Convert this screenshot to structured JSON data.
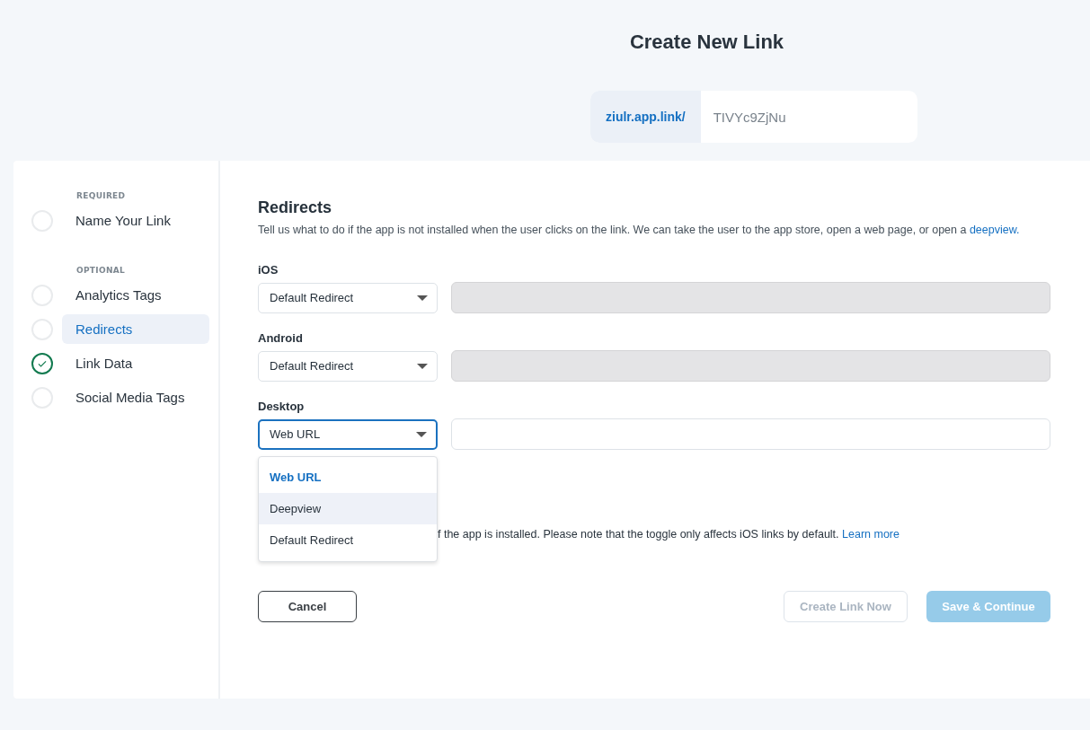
{
  "title": "Create New Link",
  "link": {
    "domain": "ziulr.app.link/",
    "slug": "TIVYc9ZjNu"
  },
  "sidebar": {
    "groups": [
      {
        "heading": "REQUIRED",
        "items": [
          {
            "label": "Name Your Link",
            "selected": false,
            "completed": false
          }
        ]
      },
      {
        "heading": "OPTIONAL",
        "items": [
          {
            "label": "Analytics Tags",
            "selected": false,
            "completed": false
          },
          {
            "label": "Redirects",
            "selected": true,
            "completed": false
          },
          {
            "label": "Link Data",
            "selected": false,
            "completed": true
          },
          {
            "label": "Social Media Tags",
            "selected": false,
            "completed": false
          }
        ]
      }
    ]
  },
  "section": {
    "heading": "Redirects",
    "description": "Tell us what to do if the app is not installed when the user clicks on the link. We can take the user to the app store, open a web page, or open a",
    "description_link": "deepview."
  },
  "platforms": [
    {
      "label": "iOS",
      "select": "Default Redirect",
      "focused": false,
      "url_disabled": true
    },
    {
      "label": "Android",
      "select": "Default Redirect",
      "focused": false,
      "url_disabled": true
    },
    {
      "label": "Desktop",
      "select": "Web URL",
      "focused": true,
      "url_disabled": false
    }
  ],
  "dropdown": {
    "options": [
      {
        "label": "Web URL",
        "selected": true,
        "highlighted": false
      },
      {
        "label": "Deepview",
        "selected": false,
        "highlighted": true
      },
      {
        "label": "Default Redirect",
        "selected": false,
        "highlighted": false
      }
    ]
  },
  "note": {
    "text": "f the app is installed. Please note that the toggle only affects iOS links by default.",
    "link": "Learn more"
  },
  "buttons": [
    {
      "label": "Cancel",
      "kind": "outline",
      "disabled": false
    },
    {
      "label": "Create Link Now",
      "kind": "outline",
      "disabled": true
    },
    {
      "label": "Save & Continue",
      "kind": "primary",
      "disabled": true
    }
  ]
}
